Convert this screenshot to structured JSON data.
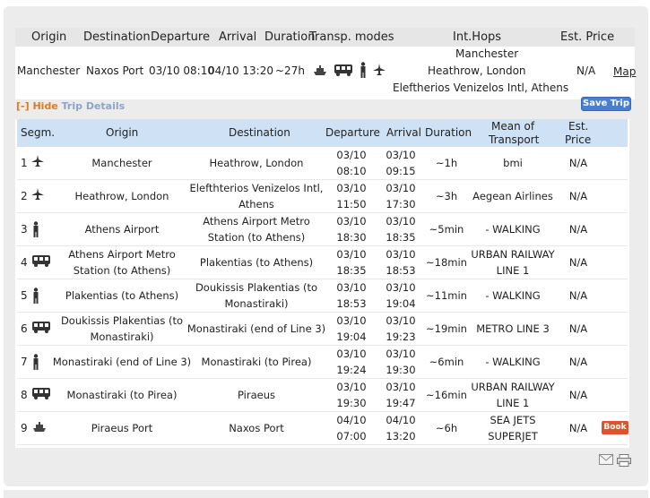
{
  "summary": {
    "headers": [
      "Origin",
      "Destination",
      "Departure",
      "Arrival",
      "Duration",
      "Transp. modes",
      "Int.Hops",
      "Est. Price"
    ],
    "row": {
      "origin": "Manchester",
      "destination": "Naxos Port",
      "departure": "03/10 08:10",
      "arrival": "04/10 13:20",
      "duration": "~27h",
      "int_hops": [
        "Manchester",
        "Heathrow, London",
        "Eleftherios Venizelos Intl, Athens"
      ],
      "price": "N/A",
      "map_label": "Map"
    },
    "transport_icons": [
      "ship-icon",
      "bus-icon",
      "walking-icon",
      "plane-icon"
    ]
  },
  "toggle": {
    "bracket": "[-]",
    "hide": "Hide",
    "label": "Trip Details"
  },
  "save_trip": "Save Trip",
  "details": {
    "headers": {
      "segm": "Segm.",
      "origin": "Origin",
      "destination": "Destination",
      "departure": "Departure",
      "arrival": "Arrival",
      "duration": "Duration",
      "mean1": "Mean of",
      "mean2": "Transport",
      "est1": "Est.",
      "est2": "Price"
    },
    "rows": [
      {
        "seg": "1",
        "icon": "plane-icon",
        "o1": "Manchester",
        "o2": "",
        "d1": "Heathrow, London",
        "d2": "",
        "dep1": "03/10",
        "dep2": "08:10",
        "arr1": "03/10",
        "arr2": "09:15",
        "dur": "~1h",
        "m1": "bmi",
        "m2": "",
        "price": "N/A"
      },
      {
        "seg": "2",
        "icon": "plane-icon",
        "o1": "Heathrow, London",
        "o2": "",
        "d1": "Elefthterios Venizelos Intl,",
        "d2": "Athens",
        "dep1": "03/10",
        "dep2": "11:50",
        "arr1": "03/10",
        "arr2": "17:30",
        "dur": "~3h",
        "m1": "Aegean Airlines",
        "m2": "",
        "price": "N/A"
      },
      {
        "seg": "3",
        "icon": "walking-icon",
        "o1": "Athens Airport",
        "o2": "",
        "d1": "Athens Airport Metro",
        "d2": "Station (to Athens)",
        "dep1": "03/10",
        "dep2": "18:30",
        "arr1": "03/10",
        "arr2": "18:35",
        "dur": "~5min",
        "m1": "- WALKING",
        "m2": "",
        "price": "N/A"
      },
      {
        "seg": "4",
        "icon": "bus-icon",
        "o1": "Athens Airport Metro",
        "o2": "Station (to Athens)",
        "d1": "Plakentias (to Athens)",
        "d2": "",
        "dep1": "03/10",
        "dep2": "18:35",
        "arr1": "03/10",
        "arr2": "18:53",
        "dur": "~18min",
        "m1": "URBAN RAILWAY",
        "m2": "LINE 1",
        "price": "N/A"
      },
      {
        "seg": "5",
        "icon": "walking-icon",
        "o1": "Plakentias (to Athens)",
        "o2": "",
        "d1": "Doukissis Plakentias (to",
        "d2": "Monastiraki)",
        "dep1": "03/10",
        "dep2": "18:53",
        "arr1": "03/10",
        "arr2": "19:04",
        "dur": "~11min",
        "m1": "- WALKING",
        "m2": "",
        "price": "N/A"
      },
      {
        "seg": "6",
        "icon": "bus-icon",
        "o1": "Doukissis Plakentias (to",
        "o2": "Monastiraki)",
        "d1": "Monastiraki (end of Line 3)",
        "d2": "",
        "dep1": "03/10",
        "dep2": "19:04",
        "arr1": "03/10",
        "arr2": "19:23",
        "dur": "~19min",
        "m1": "METRO LINE 3",
        "m2": "",
        "price": "N/A"
      },
      {
        "seg": "7",
        "icon": "walking-icon",
        "o1": "Monastiraki (end of Line 3)",
        "o2": "",
        "d1": "Monastiraki (to Pirea)",
        "d2": "",
        "dep1": "03/10",
        "dep2": "19:24",
        "arr1": "03/10",
        "arr2": "19:30",
        "dur": "~6min",
        "m1": "- WALKING",
        "m2": "",
        "price": "N/A"
      },
      {
        "seg": "8",
        "icon": "bus-icon",
        "o1": "Monastiraki (to Pirea)",
        "o2": "",
        "d1": "Piraeus",
        "d2": "",
        "dep1": "03/10",
        "dep2": "19:30",
        "arr1": "03/10",
        "arr2": "19:47",
        "dur": "~16min",
        "m1": "URBAN RAILWAY",
        "m2": "LINE 1",
        "price": "N/A"
      },
      {
        "seg": "9",
        "icon": "ship-icon",
        "o1": "Piraeus Port",
        "o2": "",
        "d1": "Naxos Port",
        "d2": "",
        "dep1": "04/10",
        "dep2": "07:00",
        "arr1": "04/10",
        "arr2": "13:20",
        "dur": "~6h",
        "m1": "SEA JETS",
        "m2": "SUPERJET",
        "price": "N/A",
        "book": "Book"
      }
    ]
  },
  "footer_icons": [
    "email-icon",
    "print-icon"
  ]
}
